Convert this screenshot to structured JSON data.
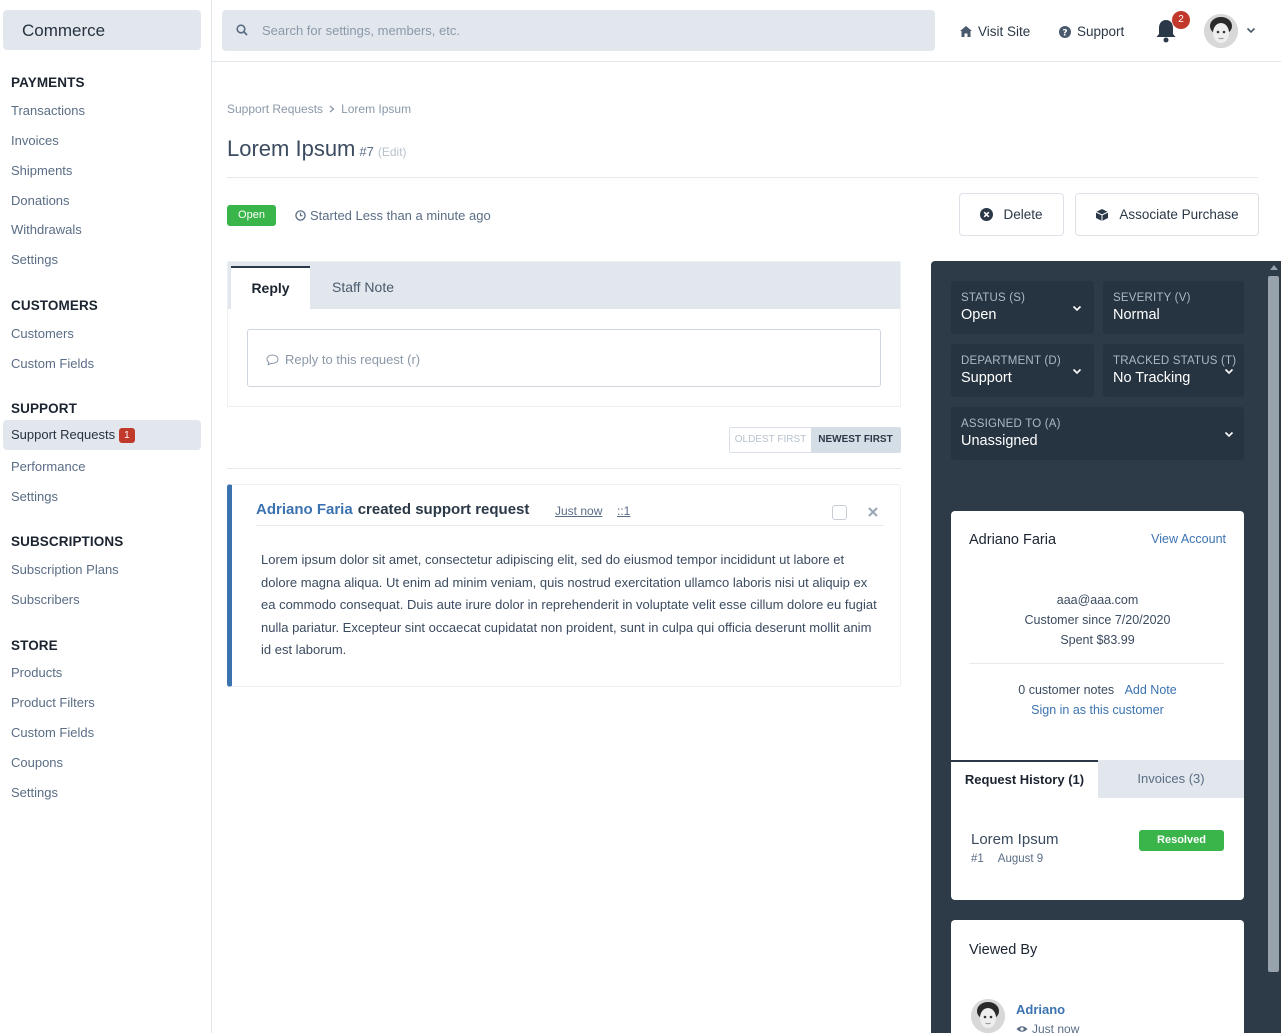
{
  "app": {
    "brand": "Commerce"
  },
  "sidebar": {
    "sections": [
      {
        "title": "PAYMENTS",
        "items": [
          "Transactions",
          "Invoices",
          "Shipments",
          "Donations",
          "Withdrawals",
          "Settings"
        ]
      },
      {
        "title": "CUSTOMERS",
        "items": [
          "Customers",
          "Custom Fields"
        ]
      },
      {
        "title": "SUPPORT",
        "items": [
          "Support Requests",
          "Performance",
          "Settings"
        ]
      },
      {
        "title": "SUBSCRIPTIONS",
        "items": [
          "Subscription Plans",
          "Subscribers"
        ]
      },
      {
        "title": "STORE",
        "items": [
          "Products",
          "Product Filters",
          "Custom Fields",
          "Coupons",
          "Settings"
        ]
      }
    ],
    "active_badge": "1"
  },
  "topbar": {
    "search_placeholder": "Search for settings, members, etc.",
    "visit_site": "Visit Site",
    "support": "Support",
    "notifications_count": "2"
  },
  "page": {
    "breadcrumb": [
      "Support Requests",
      "Lorem Ipsum"
    ],
    "title": "Lorem Ipsum",
    "number": "#7",
    "edit": "(Edit)",
    "status": "Open",
    "started": "Started Less than a minute ago",
    "delete": "Delete",
    "associate": "Associate Purchase"
  },
  "reply": {
    "tab_reply": "Reply",
    "tab_staff": "Staff Note",
    "placeholder": "Reply to this request (r)",
    "sort_oldest": "OLDEST FIRST",
    "sort_newest": "NEWEST FIRST"
  },
  "message": {
    "author": "Adriano Faria",
    "action": "created support request",
    "time": "Just now",
    "id": "::1",
    "body": "Lorem ipsum dolor sit amet, consectetur adipiscing elit, sed do eiusmod tempor incididunt ut labore et dolore magna aliqua. Ut enim ad minim veniam, quis nostrud exercitation ullamco laboris nisi ut aliquip ex ea commodo consequat. Duis aute irure dolor in reprehenderit in voluptate velit esse cillum dolore eu fugiat nulla pariatur. Excepteur sint occaecat cupidatat non proident, sunt in culpa qui officia deserunt mollit anim id est laborum."
  },
  "properties": {
    "status": {
      "label": "STATUS (S)",
      "value": "Open"
    },
    "severity": {
      "label": "SEVERITY (V)",
      "value": "Normal"
    },
    "department": {
      "label": "DEPARTMENT (D)",
      "value": "Support"
    },
    "tracked": {
      "label": "TRACKED STATUS (T)",
      "value": "No Tracking"
    },
    "assigned": {
      "label": "ASSIGNED TO (A)",
      "value": "Unassigned"
    }
  },
  "customer": {
    "name": "Adriano Faria",
    "view_account": "View Account",
    "email": "aaa@aaa.com",
    "since": "Customer since 7/20/2020",
    "spent": "Spent $83.99",
    "notes": "0 customer notes",
    "add_note": "Add Note",
    "sign_in": "Sign in as this customer",
    "tab_history": "Request History (1)",
    "tab_invoices": "Invoices (3)",
    "history_title": "Lorem Ipsum",
    "history_num": "#1",
    "history_date": "August 9",
    "history_status": "Resolved"
  },
  "viewed": {
    "title": "Viewed By",
    "name": "Adriano",
    "time": "Just now"
  },
  "colors": {
    "accent": "#3b73b0",
    "success": "#39b54a",
    "danger": "#c0392b",
    "panel": "#2d3a48"
  }
}
